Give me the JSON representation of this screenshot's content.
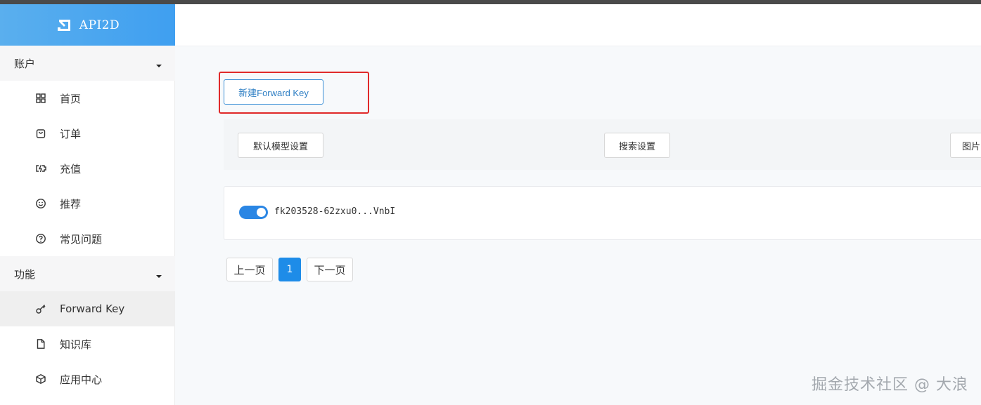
{
  "brand": {
    "name": "API2D"
  },
  "sidebar": {
    "groups": [
      {
        "label": "账户",
        "items": [
          {
            "label": "首页",
            "icon": "grid-icon"
          },
          {
            "label": "订单",
            "icon": "shopping-bag-icon"
          },
          {
            "label": "充值",
            "icon": "battery-charge-icon"
          },
          {
            "label": "推荐",
            "icon": "smiley-icon"
          },
          {
            "label": "常见问题",
            "icon": "question-circle-icon"
          }
        ]
      },
      {
        "label": "功能",
        "items": [
          {
            "label": "Forward Key",
            "icon": "key-icon",
            "active": true
          },
          {
            "label": "知识库",
            "icon": "document-icon"
          },
          {
            "label": "应用中心",
            "icon": "cube-icon"
          }
        ]
      }
    ]
  },
  "main": {
    "new_key_button": "新建Forward Key",
    "settings": {
      "default_model_button": "默认模型设置",
      "search_settings_button": "搜索设置",
      "image_button_partial": "图片"
    },
    "keys": [
      {
        "enabled": true,
        "key": "fk203528-62zxu0...VnbI"
      }
    ],
    "pagination": {
      "prev": "上一页",
      "current": "1",
      "next": "下一页"
    }
  },
  "watermark": "掘金技术社区 @ 大浪",
  "colors": {
    "brand_gradient_start": "#5aafee",
    "brand_gradient_end": "#3f9ff0",
    "accent": "#1e8ce8",
    "highlight": "#e02a2a"
  }
}
